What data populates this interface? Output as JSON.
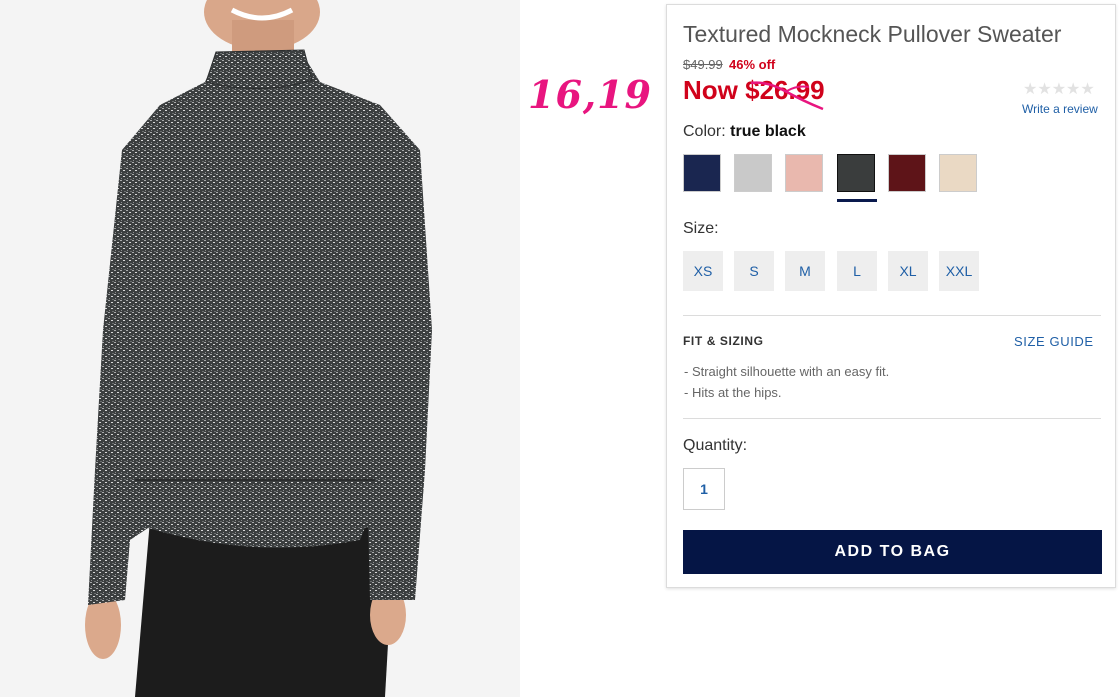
{
  "annotation": {
    "text": "16,19",
    "color": "#e8157f"
  },
  "product": {
    "title": "Textured Mockneck Pullover Sweater",
    "original_price": "$49.99",
    "discount": "46% off",
    "now_price": "Now $26.99",
    "review_link": "Write a review",
    "rating_stars": "★★★★★"
  },
  "color": {
    "label": "Color:",
    "selected": "true black",
    "swatches": [
      {
        "name": "navy",
        "hex": "#1a2650"
      },
      {
        "name": "light gray",
        "hex": "#c9c9c9"
      },
      {
        "name": "pink",
        "hex": "#e9b8ae"
      },
      {
        "name": "true black",
        "hex": "#3a3d3d"
      },
      {
        "name": "burgundy",
        "hex": "#5e1418"
      },
      {
        "name": "cream",
        "hex": "#ead9c4"
      }
    ]
  },
  "size": {
    "label": "Size:",
    "options": [
      "XS",
      "S",
      "M",
      "L",
      "XL",
      "XXL"
    ]
  },
  "fit": {
    "title": "FIT & SIZING",
    "guide_link": "SIZE GUIDE",
    "bullets": [
      "- Straight silhouette with an easy fit.",
      "- Hits at the hips."
    ]
  },
  "quantity": {
    "label": "Quantity:",
    "value": "1"
  },
  "cta": {
    "add_to_bag": "ADD TO BAG"
  },
  "colors": {
    "accent": "#d0021b",
    "link": "#1f5fa6",
    "button": "#051545"
  }
}
